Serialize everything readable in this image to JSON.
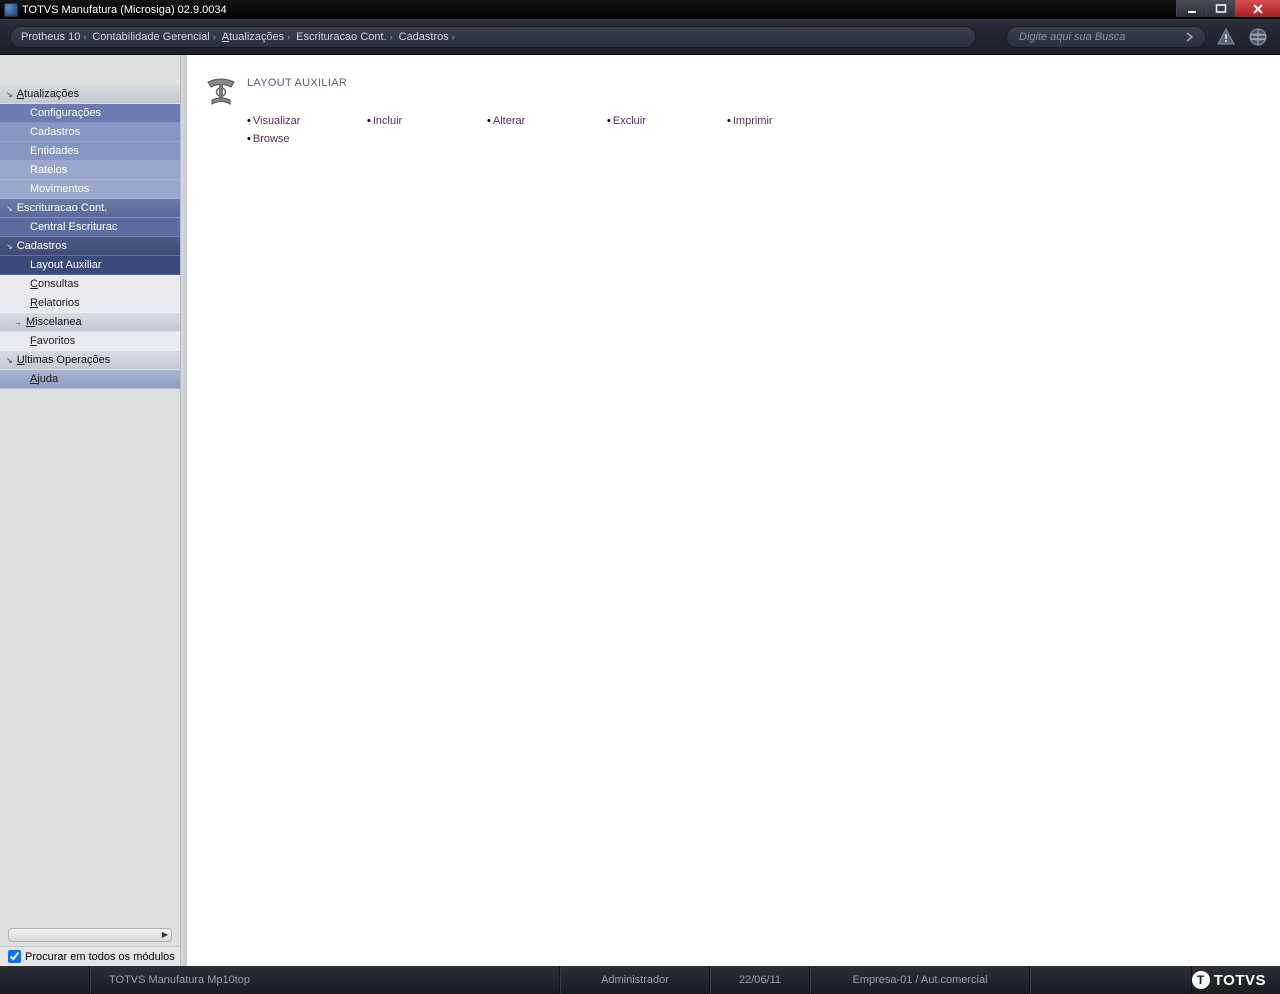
{
  "window": {
    "title": "TOTVS Manufatura (Microsiga) 02.9.0034"
  },
  "breadcrumb": [
    {
      "label": "Protheus 10"
    },
    {
      "label": "Contabilidade Gerencial"
    },
    {
      "label": "Atualizações"
    },
    {
      "label": "Escrituracao Cont."
    },
    {
      "label": "Cadastros"
    }
  ],
  "search": {
    "placeholder": "Digite aqui sua Busca"
  },
  "sidebar": {
    "atualizacoes": "Atualizações",
    "sub_config": "Configurações",
    "sub_cadastros": "Cadastros",
    "sub_entidades": "Entidades",
    "sub_rateios": "Rateios",
    "sub_movimentos": "Movimentos",
    "escrituracao": "Escrituracao Cont.",
    "central": "Central Escriturac",
    "cadastros": "Cadastros",
    "layout": "Layout Auxiliar",
    "consultas": "Consultas",
    "relatorios": "Relatorios",
    "miscelanea": "Miscelanea",
    "favoritos": "Favoritos",
    "ultimas": "Ultimas Operações",
    "ajuda": "Ajuda",
    "search_all": "Procurar em todos os módulos"
  },
  "content": {
    "title": "LAYOUT AUXILIAR",
    "actions": {
      "visualizar": "Visualizar",
      "incluir": "Incluir",
      "alterar": "Alterar",
      "excluir": "Excluir",
      "imprimir": "Imprimir",
      "browse": "Browse"
    }
  },
  "status": {
    "app": "TOTVS Manufatura Mp10top",
    "user": "Administrador",
    "date": "22/06/11",
    "company": "Empresa-01 / Aut.comercial",
    "brand": "TOTVS"
  }
}
